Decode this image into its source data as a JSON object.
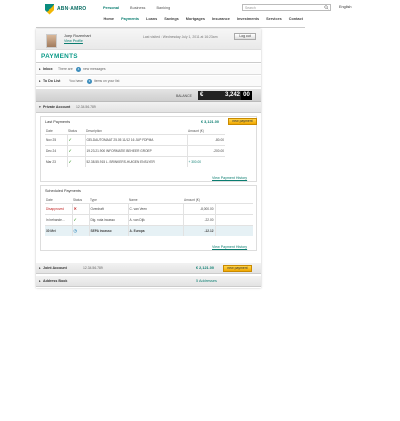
{
  "header": {
    "logo_text": "ABN·AMRO",
    "segments": [
      "Personal",
      "Business",
      "Banking"
    ],
    "active_segment": "Personal",
    "search_placeholder": "Search",
    "language": "English",
    "nav": [
      "Home",
      "Payments",
      "Loans",
      "Savings",
      "Mortgages",
      "Insurance",
      "Investments",
      "Services",
      "Contact"
    ],
    "active_nav": "Payments"
  },
  "user": {
    "name": "Joep Rozenhart",
    "profile_link": "View Profile",
    "last_visited": "Last visited : Wednesday July 1, 2011 at 16:23am",
    "logout_label": "Log out"
  },
  "page_title": "PAYMENTS",
  "inbox": {
    "label": "Inbox",
    "pre": "There are",
    "count": "4",
    "post": "new messages"
  },
  "todo": {
    "label": "To Do List",
    "pre": "You have",
    "count": "3",
    "post": "items on your list"
  },
  "balance": {
    "label": "BALANCE",
    "currency": "€",
    "value": "3,242",
    "cents": "00"
  },
  "private_account": {
    "label": "Private Account",
    "number": "12.34.56.789"
  },
  "last_payments": {
    "title": "Last Payments",
    "amount": "€ 3,121.00",
    "new_payment_label": "new payment",
    "columns": [
      "Date",
      "Status",
      "Description",
      "Amount (€)"
    ],
    "rows": [
      {
        "date": "Nov 25",
        "status": "check",
        "description": "GELDAUTOMAAT 25.05 11/12 16 JUP FDPMA",
        "amount": "-80.00"
      },
      {
        "date": "Dec 24",
        "status": "check",
        "description": "19.23.21.900 INFORMATIE BEHEER GROEP",
        "amount": "-200.00"
      },
      {
        "date": "Mar 23",
        "status": "check",
        "description": "52.38.55.915 L. BRINKERS-HUIGEN ENSLYER",
        "amount": "+ 300.00"
      }
    ],
    "history_link": "View Payment History"
  },
  "scheduled_payments": {
    "title": "Scheduled Payments",
    "columns": [
      "Date",
      "Status",
      "Type",
      "Name",
      "Amount (€)"
    ],
    "rows": [
      {
        "date": "Disapproved",
        "status": "cross",
        "type": "Overdraft",
        "name": "C. van Veen",
        "amount": "-8,000.00"
      },
      {
        "date": "In behande...",
        "status": "check",
        "type": "Dig. nota incasso",
        "name": "A. van Dijk",
        "amount": "-22.00"
      },
      {
        "date": "30 Mei",
        "status": "clock",
        "type": "SEPA incasso",
        "name": "A. Europa",
        "amount": "-12.12"
      }
    ],
    "history_link": "View Payment History"
  },
  "joint_account": {
    "label": "Joint Account",
    "number": "12.34.56.789",
    "amount": "€ 2,121.00",
    "new_payment_label": "new payment"
  },
  "address_book": {
    "label": "Address Book",
    "count_text": "5 Addresses"
  },
  "colors": {
    "brand": "#0a7d70",
    "accent": "#f0a800"
  }
}
